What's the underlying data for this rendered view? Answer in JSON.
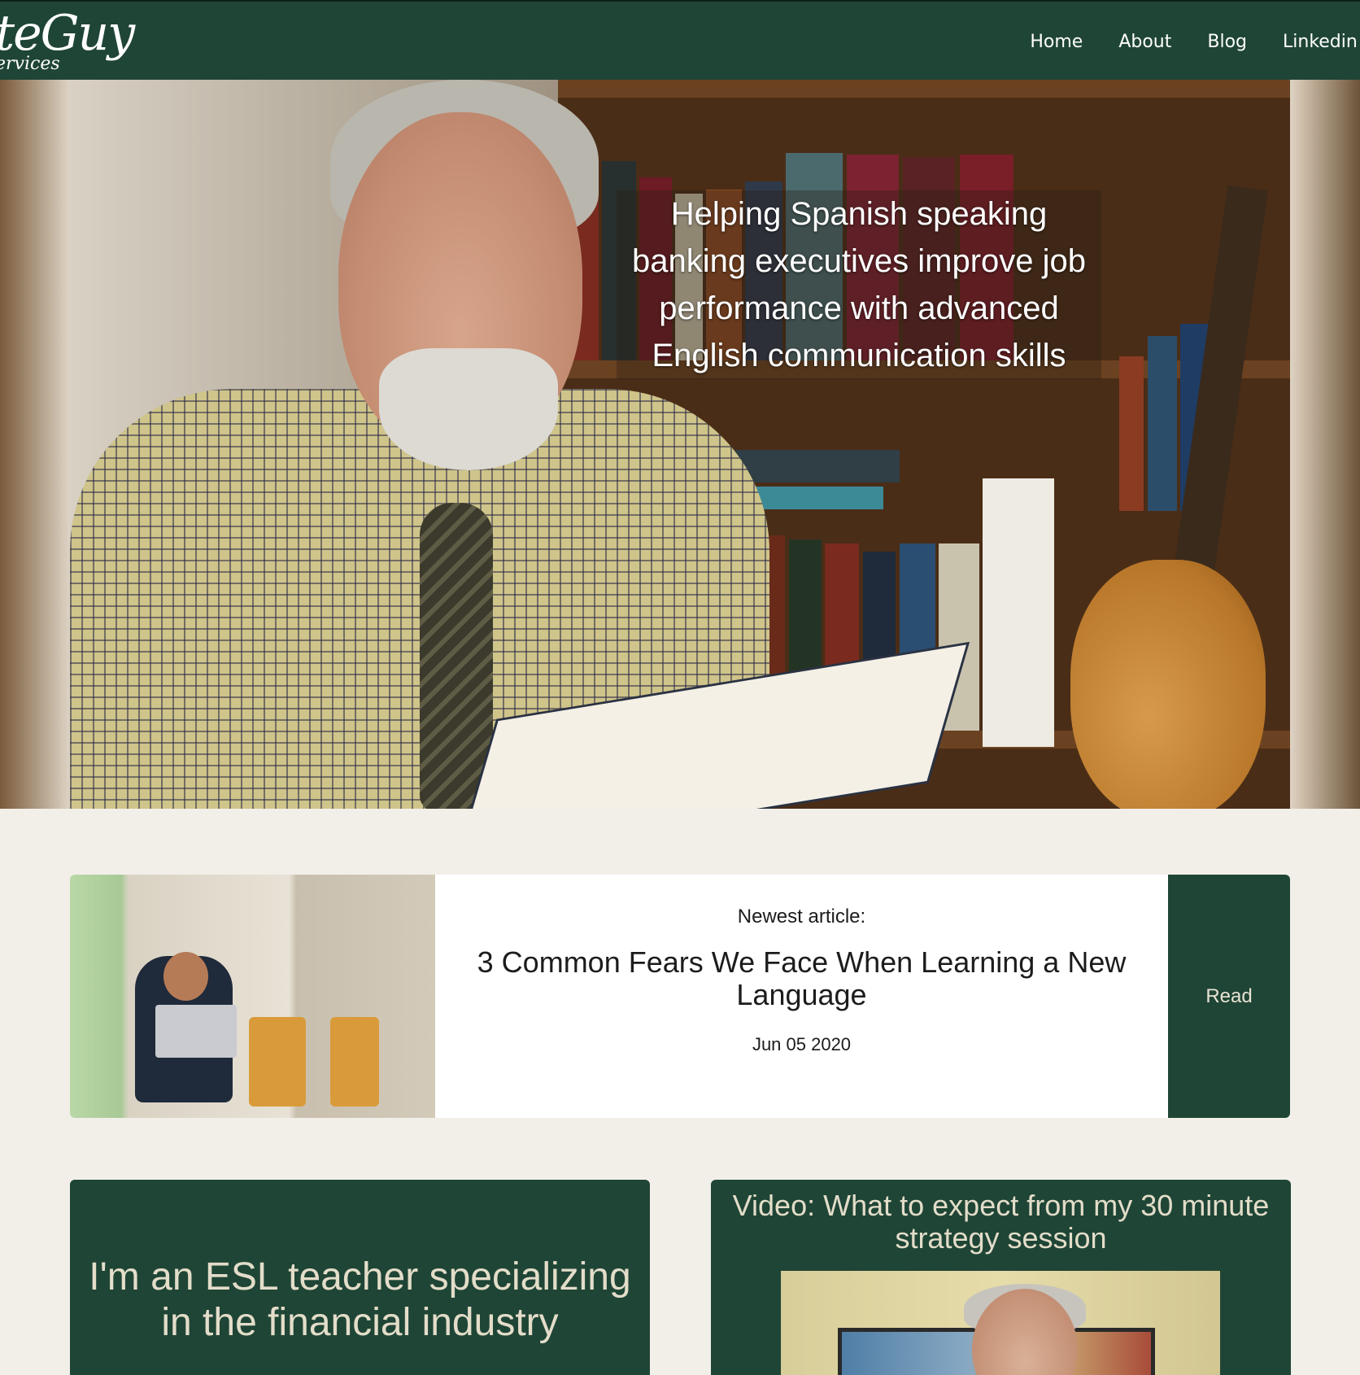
{
  "header": {
    "logo_main": "teGuy",
    "logo_sub": "ervices",
    "nav": [
      "Home",
      "About",
      "Blog",
      "Linkedin"
    ]
  },
  "hero": {
    "tagline": "Helping Spanish speaking banking executives improve job performance with advanced English communication skills"
  },
  "newest_article": {
    "kicker": "Newest article:",
    "title": "3 Common Fears We Face When Learning a New Language",
    "date": "Jun 05 2020",
    "read_label": "Read"
  },
  "intro_card": {
    "text": "I'm an ESL teacher specializing in the financial industry"
  },
  "video_card": {
    "title": "Video: What to expect from my 30 minute strategy session"
  },
  "colors": {
    "brand_green": "#1f4536",
    "page_bg": "#f2efe9"
  }
}
